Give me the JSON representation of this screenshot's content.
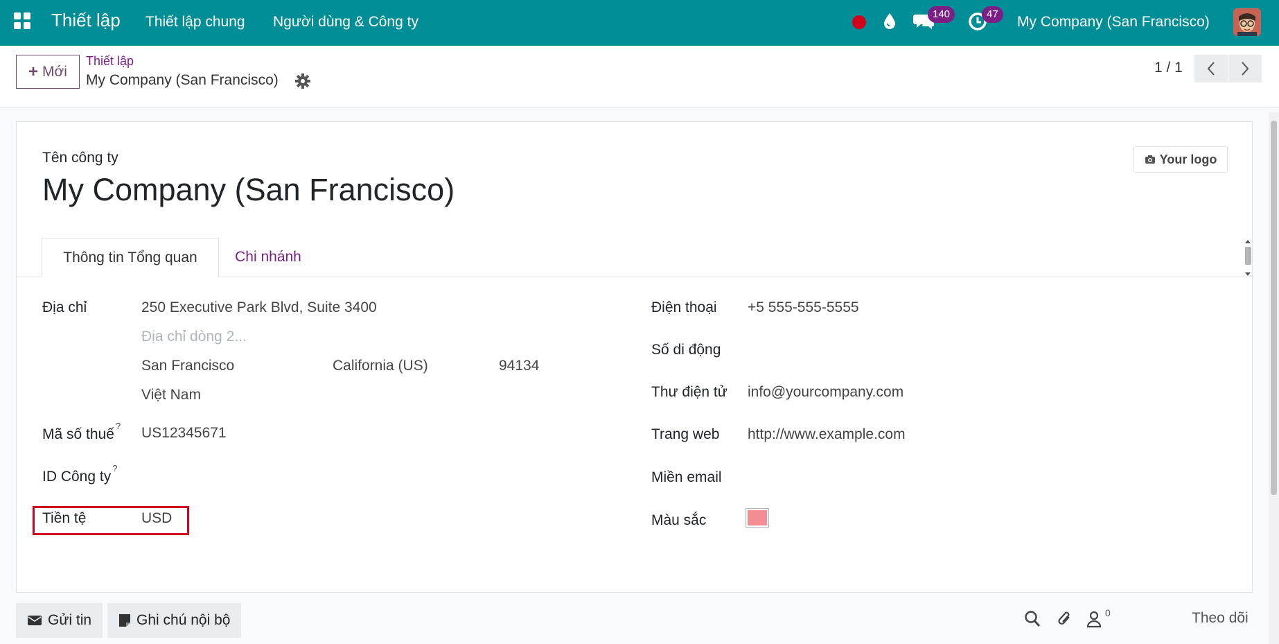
{
  "navbar": {
    "app_title": "Thiết lập",
    "menu": [
      "Thiết lập chung",
      "Người dùng & Công ty"
    ],
    "messages_count": "140",
    "activities_count": "47",
    "company": "My Company (San Francisco)",
    "colors": {
      "bar": "#018e97",
      "badge": "#7b1f87",
      "record": "#d0021b"
    }
  },
  "control": {
    "new_label": "Mới",
    "breadcrumb_parent": "Thiết lập",
    "breadcrumb_current": "My Company (San Francisco)",
    "pager": "1 / 1"
  },
  "form": {
    "company_name_label": "Tên công ty",
    "company_name": "My Company (San Francisco)",
    "logo_label": "Your logo",
    "tabs": [
      "Thông tin Tổng quan",
      "Chi nhánh"
    ],
    "address_label": "Địa chỉ",
    "street": "250 Executive Park Blvd, Suite 3400",
    "street2_placeholder": "Địa chỉ dòng 2...",
    "city": "San Francisco",
    "state": "California (US)",
    "zip": "94134",
    "country": "Việt Nam",
    "vat_label": "Mã số thuế",
    "vat": "US12345671",
    "company_id_label": "ID Công ty",
    "help_mark": "?",
    "currency_label": "Tiền tệ",
    "currency": "USD",
    "phone_label": "Điện thoại",
    "phone": "+5 555-555-5555",
    "mobile_label": "Số di động",
    "email_label": "Thư điện tử",
    "email": "info@yourcompany.com",
    "website_label": "Trang web",
    "website": "http://www.example.com",
    "email_domain_label": "Miền email",
    "color_label": "Màu sắc",
    "color_value": "#f48c94"
  },
  "chatter": {
    "send_message": "Gửi tin",
    "log_note": "Ghi chú nội bộ",
    "followers_count": "0",
    "follow": "Theo dõi"
  }
}
